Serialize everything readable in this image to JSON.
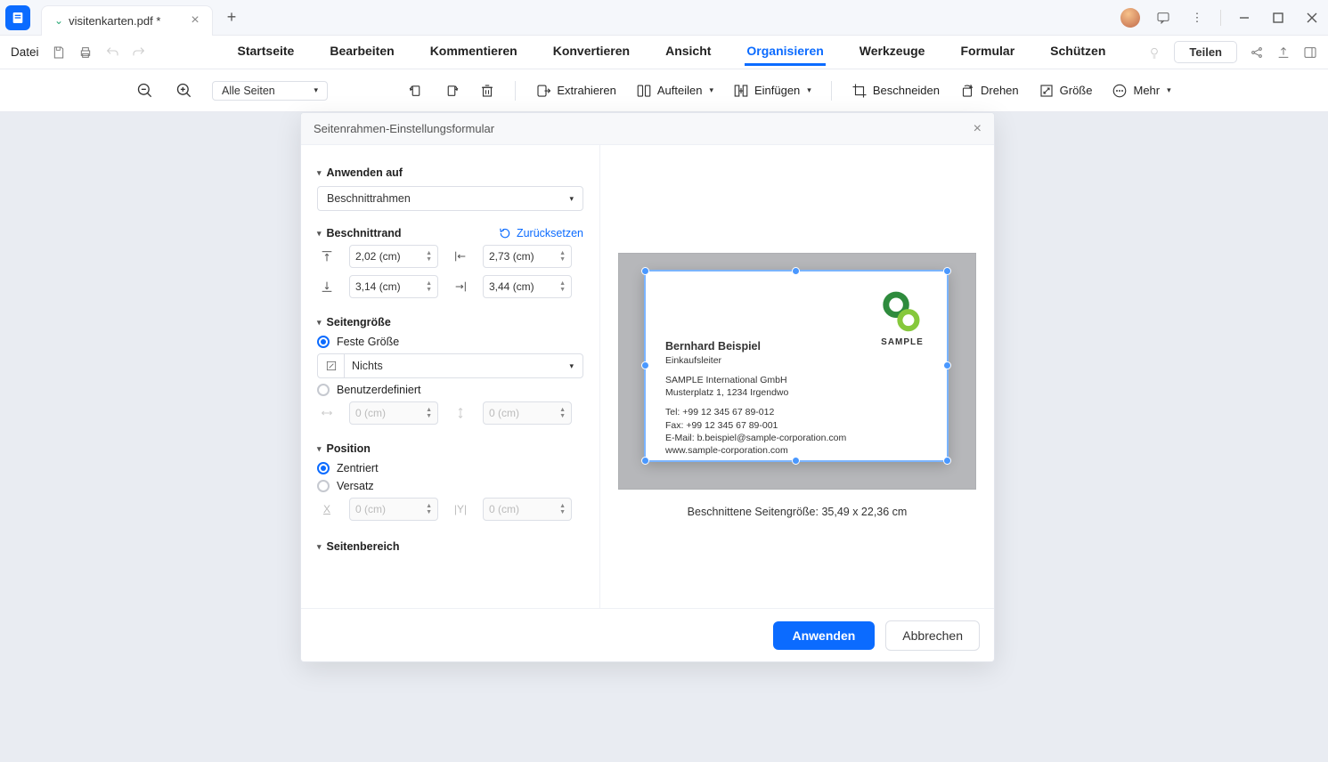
{
  "titlebar": {
    "tab_name": "visitenkarten.pdf *"
  },
  "menubar": {
    "file": "Datei",
    "items": [
      "Startseite",
      "Bearbeiten",
      "Kommentieren",
      "Konvertieren",
      "Ansicht",
      "Organisieren",
      "Werkzeuge",
      "Formular",
      "Schützen"
    ],
    "active_index": 5,
    "share": "Teilen"
  },
  "toolbar": {
    "all_pages": "Alle Seiten",
    "extract": "Extrahieren",
    "split": "Aufteilen",
    "insert": "Einfügen",
    "crop": "Beschneiden",
    "rotate": "Drehen",
    "size": "Größe",
    "more": "Mehr"
  },
  "dialog": {
    "title": "Seitenrahmen-Einstellungsformular",
    "apply_to": "Anwenden auf",
    "apply_to_value": "Beschnittrahmen",
    "crop_margin": "Beschnittrand",
    "reset": "Zurücksetzen",
    "margins": {
      "top": "2,02 (cm)",
      "left": "2,73 (cm)",
      "bottom": "3,14 (cm)",
      "right": "3,44 (cm)"
    },
    "page_size": "Seitengröße",
    "fixed_size": "Feste Größe",
    "fixed_size_value": "Nichts",
    "custom": "Benutzerdefiniert",
    "zero_cm": "0 (cm)",
    "position": "Position",
    "centered": "Zentriert",
    "offset": "Versatz",
    "page_range": "Seitenbereich",
    "apply": "Anwenden",
    "cancel": "Abbrechen",
    "crop_info": "Beschnittene Seitengröße: 35,49 x 22,36 cm"
  },
  "card": {
    "name": "Bernhard Beispiel",
    "role": "Einkaufsleiter",
    "company": "SAMPLE International GmbH",
    "address": "Musterplatz 1, 1234 Irgendwo",
    "tel": "Tel: +99 12 345 67 89-012",
    "fax": "Fax: +99 12 345 67 89-001",
    "email": "E-Mail: b.beispiel@sample-corporation.com",
    "web": "www.sample-corporation.com",
    "logo_text": "SAMPLE"
  }
}
